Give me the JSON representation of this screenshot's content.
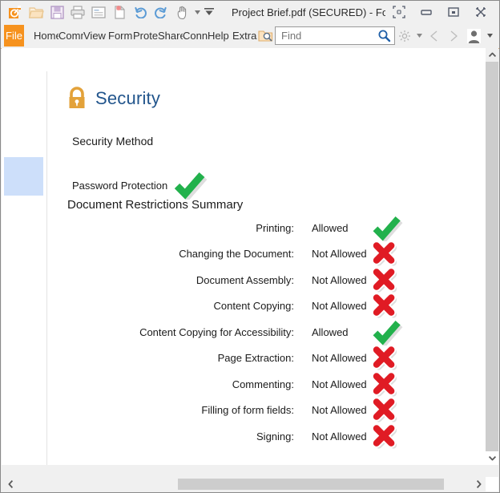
{
  "window": {
    "title": "Project Brief.pdf (SECURED) - Foxit Re...",
    "quick_access": [
      {
        "name": "app-logo-icon",
        "label": "Foxit"
      },
      {
        "name": "open-icon",
        "label": "Open"
      },
      {
        "name": "save-icon",
        "label": "Save"
      },
      {
        "name": "print-icon",
        "label": "Print"
      },
      {
        "name": "email-icon",
        "label": "Email"
      },
      {
        "name": "new-blank-page-icon",
        "label": "New"
      },
      {
        "name": "undo-icon",
        "label": "Undo"
      },
      {
        "name": "redo-icon",
        "label": "Redo"
      },
      {
        "name": "hand-tool-icon",
        "label": "Hand Tool"
      },
      {
        "name": "customize-toolbar-icon",
        "label": "Customize"
      }
    ],
    "controls": [
      {
        "name": "fit-window-button",
        "label": "Fit"
      },
      {
        "name": "minimize-button",
        "label": "Minimize"
      },
      {
        "name": "restore-button",
        "label": "Restore"
      },
      {
        "name": "close-button",
        "label": "Close"
      }
    ]
  },
  "menubar": {
    "file_label": "File",
    "tabs": [
      "Home",
      "Comment",
      "View",
      "Form",
      "Protect",
      "Share",
      "Connect",
      "Help",
      "Extras"
    ],
    "search_icon": "search-folder-icon",
    "find": {
      "value": "",
      "placeholder": "Find"
    },
    "gear_label": "Settings",
    "prev_label": "Previous View",
    "next_label": "Next View",
    "account_label": "Account"
  },
  "document": {
    "heading": "Security",
    "heading_icon": "lock-icon",
    "security_method_label": "Security Method",
    "password_protection_label": "Password Protection",
    "password_protection_status": "allowed",
    "restrictions_heading": "Document Restrictions Summary",
    "restrictions": [
      {
        "label": "Printing:",
        "value": "Allowed",
        "status": "allowed"
      },
      {
        "label": "Changing the Document:",
        "value": "Not Allowed",
        "status": "denied"
      },
      {
        "label": "Document Assembly:",
        "value": "Not Allowed",
        "status": "denied"
      },
      {
        "label": "Content Copying:",
        "value": "Not Allowed",
        "status": "denied"
      },
      {
        "label": "Content Copying for Accessibility:",
        "value": "Allowed",
        "status": "allowed"
      },
      {
        "label": "Page Extraction:",
        "value": "Not Allowed",
        "status": "denied"
      },
      {
        "label": "Commenting:",
        "value": "Not Allowed",
        "status": "denied"
      },
      {
        "label": "Filling of form fields:",
        "value": "Not Allowed",
        "status": "denied"
      },
      {
        "label": "Signing:",
        "value": "Not Allowed",
        "status": "denied"
      }
    ]
  },
  "scrollbars": {
    "vertical_up_label": "Scroll Up",
    "vertical_down_label": "Scroll Down",
    "horizontal_left_label": "Scroll Left",
    "horizontal_right_label": "Scroll Right"
  },
  "colors": {
    "accent_orange": "#f6921e",
    "heading_blue": "#22558c",
    "lock_gold": "#e3a23a",
    "check_green": "#22b14c",
    "cross_red": "#e01b24",
    "selection_blue": "#cddffa",
    "scrollbar_thumb": "#cdcdcd"
  }
}
